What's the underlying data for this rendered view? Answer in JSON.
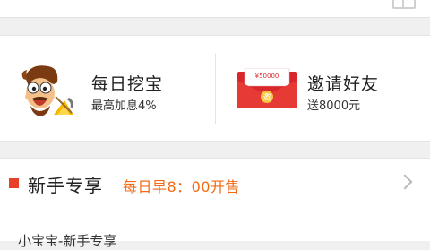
{
  "icons": {
    "top_right": "grid-icon",
    "treasure": "pirate-face-icon",
    "invite": "red-envelope-icon",
    "more": "chevron-right-icon"
  },
  "colors": {
    "accent_orange": "#f26a16",
    "accent_red": "#e8402a"
  },
  "promo": {
    "left": {
      "title": "每日挖宝",
      "subtitle": "最高加息4%"
    },
    "right": {
      "title": "邀请好友",
      "subtitle": "送8000元",
      "envelope_amount": "¥50000",
      "envelope_char": "邀"
    }
  },
  "section": {
    "title": "新手专享",
    "time_note": "每日早8：00开售"
  },
  "list": {
    "first_item": "小宝宝-新手专享"
  }
}
